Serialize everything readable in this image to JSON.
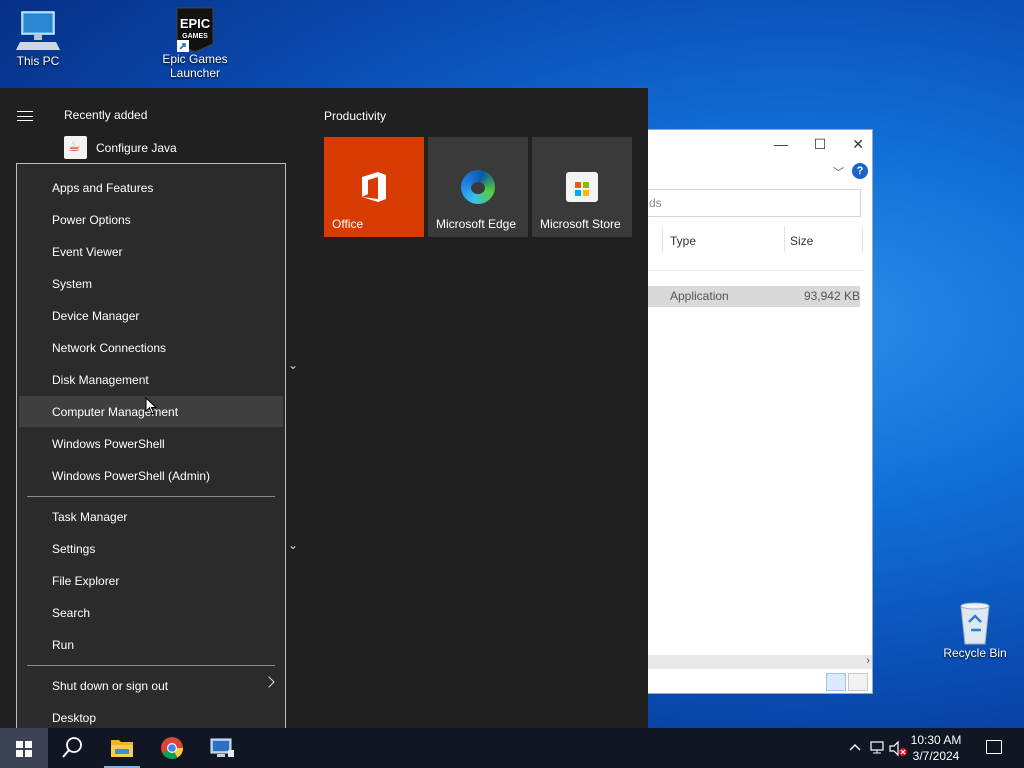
{
  "desktop": {
    "icons": [
      {
        "label": "This PC"
      },
      {
        "label": "Epic Games\nLauncher"
      },
      {
        "label": "Recycle Bin"
      }
    ],
    "epic_logo_text": [
      "EPIC",
      "GAMES"
    ]
  },
  "explorer": {
    "search_partial": "ds",
    "columns": [
      "Type",
      "Size"
    ],
    "row": {
      "type": "Application",
      "size": "93,942 KB"
    },
    "help_label": "?"
  },
  "start_menu": {
    "recently_added_label": "Recently added",
    "recent_apps": [
      {
        "label": "Configure Java"
      }
    ],
    "group_title": "Productivity",
    "tiles": [
      {
        "label": "Office",
        "color": "#d83b01"
      },
      {
        "label": "Microsoft Edge",
        "color": "#3a3a3a"
      },
      {
        "label": "Microsoft Store",
        "color": "#3a3a3a"
      }
    ]
  },
  "context_menu": {
    "group1": [
      "Apps and Features",
      "Power Options",
      "Event Viewer",
      "System",
      "Device Manager",
      "Network Connections",
      "Disk Management",
      "Computer Management",
      "Windows PowerShell",
      "Windows PowerShell (Admin)"
    ],
    "group2": [
      "Task Manager",
      "Settings",
      "File Explorer",
      "Search",
      "Run"
    ],
    "group3": [
      "Shut down or sign out",
      "Desktop"
    ],
    "hovered": "Computer Management"
  },
  "taskbar": {
    "time": "10:30 AM",
    "date": "3/7/2024",
    "accent": "#76b9ed"
  }
}
